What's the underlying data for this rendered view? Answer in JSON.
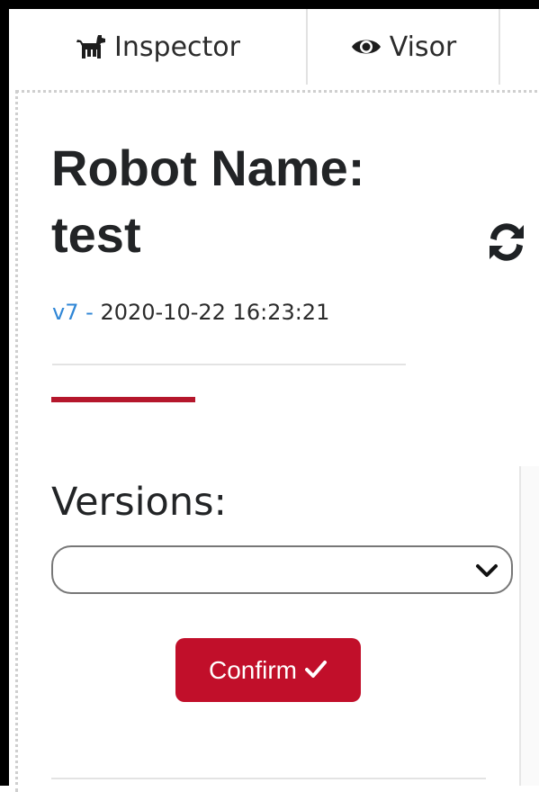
{
  "tabs": {
    "inspector": {
      "label": "Inspector",
      "icon": "dog-icon"
    },
    "visor": {
      "label": "Visor",
      "icon": "eye-icon"
    }
  },
  "robot": {
    "title_line1": "Robot Name:",
    "title_line2": "test",
    "version_link": "v7",
    "version_separator": "-",
    "timestamp": "2020-10-22 16:23:21"
  },
  "versions": {
    "label": "Versions:",
    "selected_value": ""
  },
  "confirm": {
    "label": "Confirm"
  },
  "colors": {
    "accent": "#c10f2a",
    "link": "#2f86d6",
    "text": "#222426"
  }
}
